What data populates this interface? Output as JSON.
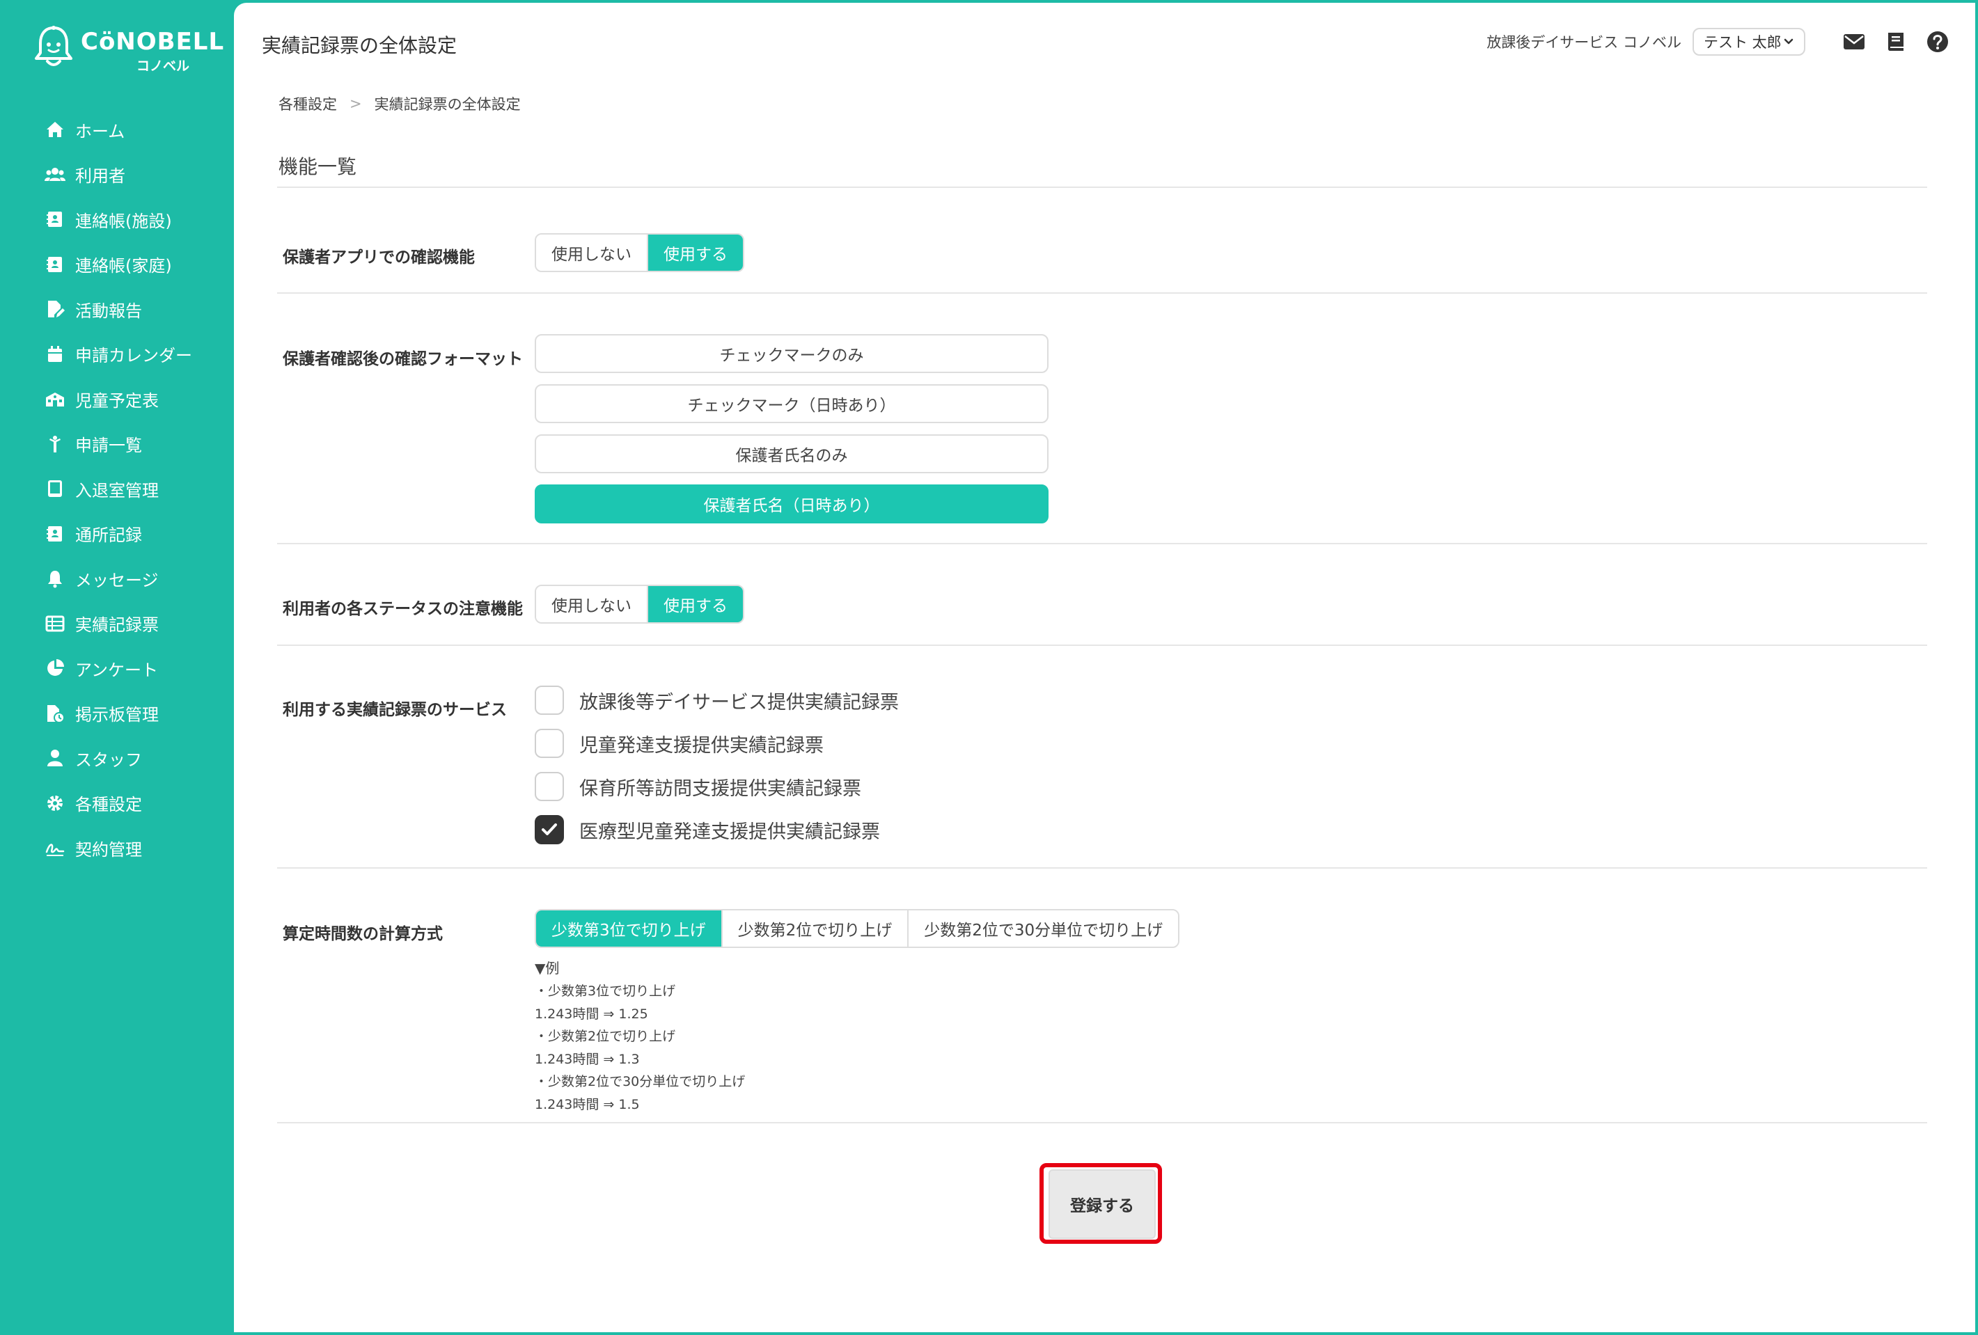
{
  "brand": {
    "logo_text": "CöNOBELL",
    "logo_sub": "コノベル"
  },
  "sidebar": {
    "items": [
      {
        "label": "ホーム",
        "icon": "home-icon"
      },
      {
        "label": "利用者",
        "icon": "users-icon"
      },
      {
        "label": "連絡帳(施設)",
        "icon": "contact-book-icon"
      },
      {
        "label": "連絡帳(家庭)",
        "icon": "contact-book-icon"
      },
      {
        "label": "活動報告",
        "icon": "file-edit-icon"
      },
      {
        "label": "申請カレンダー",
        "icon": "calendar-icon"
      },
      {
        "label": "児童予定表",
        "icon": "school-icon"
      },
      {
        "label": "申請一覧",
        "icon": "child-icon"
      },
      {
        "label": "入退室管理",
        "icon": "tablet-icon"
      },
      {
        "label": "通所記録",
        "icon": "contact-book-icon"
      },
      {
        "label": "メッセージ",
        "icon": "bell-icon"
      },
      {
        "label": "実績記録票",
        "icon": "table-icon"
      },
      {
        "label": "アンケート",
        "icon": "pie-chart-icon"
      },
      {
        "label": "掲示板管理",
        "icon": "file-clock-icon"
      },
      {
        "label": "スタッフ",
        "icon": "staff-icon"
      },
      {
        "label": "各種設定",
        "icon": "gear-icon"
      },
      {
        "label": "契約管理",
        "icon": "signature-icon"
      }
    ]
  },
  "header": {
    "title": "実績記録票の全体設定",
    "facility": "放課後デイサービス コノベル",
    "user": "テスト 太郎",
    "icons": [
      "mail-icon",
      "book-icon",
      "help-icon"
    ]
  },
  "breadcrumb": {
    "parent": "各種設定",
    "current": "実績記録票の全体設定"
  },
  "section": {
    "title": "機能一覧"
  },
  "settings": {
    "guardian_confirm": {
      "label": "保護者アプリでの確認機能",
      "options": [
        "使用しない",
        "使用する"
      ],
      "selected": 1
    },
    "confirm_format": {
      "label": "保護者確認後の確認フォーマット",
      "options": [
        "チェックマークのみ",
        "チェックマーク（日時あり）",
        "保護者氏名のみ",
        "保護者氏名（日時あり）"
      ],
      "selected": 3
    },
    "status_alert": {
      "label": "利用者の各ステータスの注意機能",
      "options": [
        "使用しない",
        "使用する"
      ],
      "selected": 1
    },
    "services": {
      "label": "利用する実績記録票のサービス",
      "items": [
        {
          "label": "放課後等デイサービス提供実績記録票",
          "checked": false
        },
        {
          "label": "児童発達支援提供実績記録票",
          "checked": false
        },
        {
          "label": "保育所等訪問支援提供実績記録票",
          "checked": false
        },
        {
          "label": "医療型児童発達支援提供実績記録票",
          "checked": true
        }
      ]
    },
    "calc_method": {
      "label": "算定時間数の計算方式",
      "options": [
        "少数第3位で切り上げ",
        "少数第2位で切り上げ",
        "少数第2位で30分単位で切り上げ"
      ],
      "selected": 0,
      "example_title": "▼例",
      "example_lines": [
        "・少数第3位で切り上げ",
        "1.243時間 ⇒ 1.25",
        "・少数第2位で切り上げ",
        "1.243時間 ⇒ 1.3",
        "・少数第2位で30分単位で切り上げ",
        "1.243時間 ⇒ 1.5"
      ]
    }
  },
  "actions": {
    "submit_label": "登録する",
    "highlight_color": "#e60012"
  },
  "colors": {
    "brand": "#1dbba6",
    "accent": "#1cc6b1",
    "checked": "#333333"
  }
}
